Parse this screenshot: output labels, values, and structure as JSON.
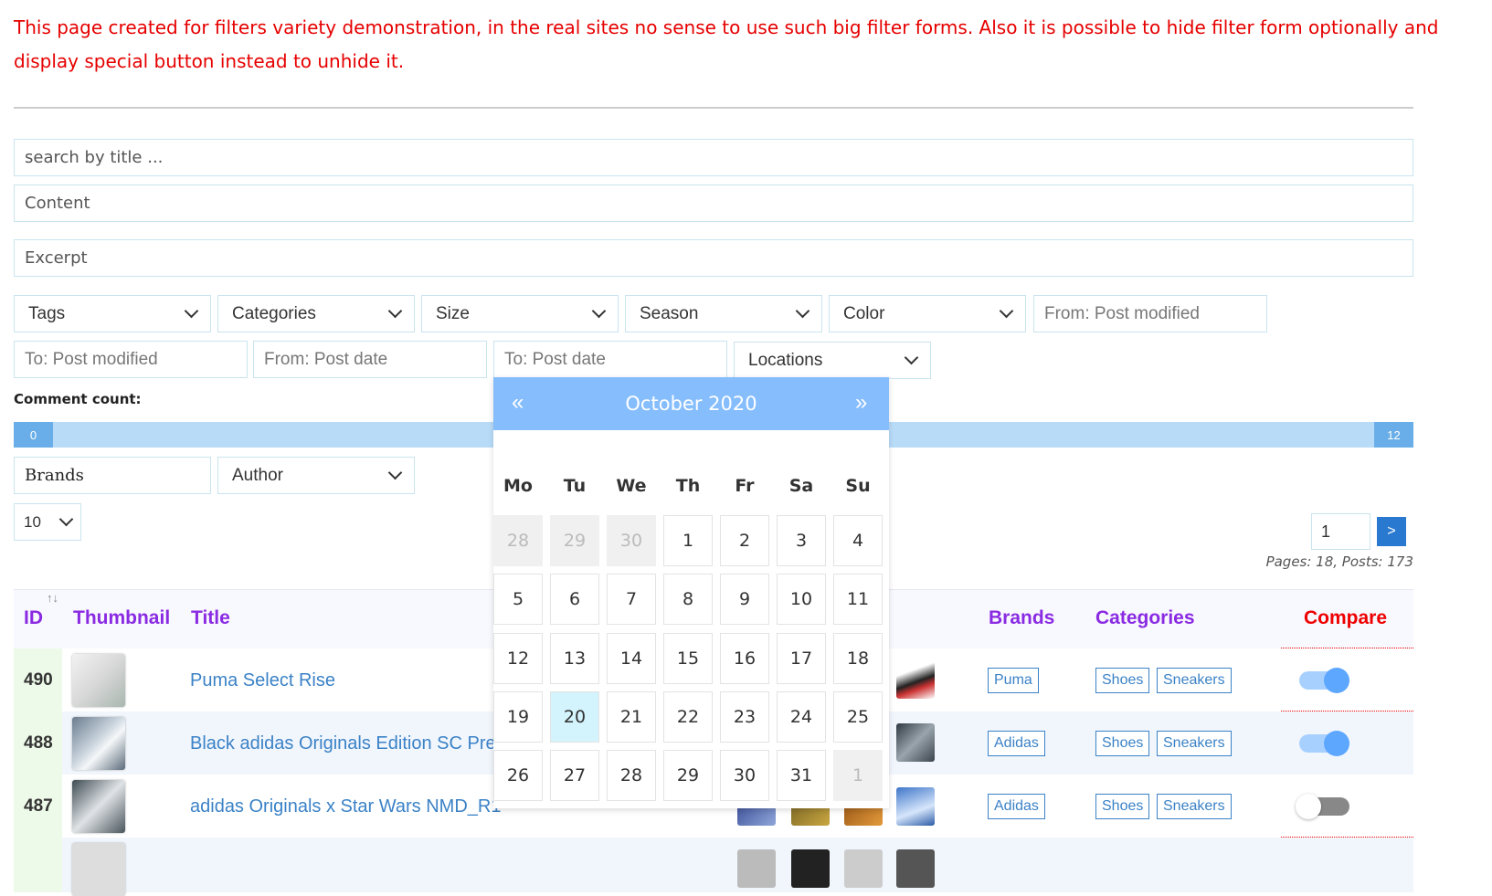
{
  "notice": "This page created for filters variety demonstration, in the real sites no sense to use such big filter forms. Also it is possible to hide filter form optionally and display special button instead to unhide it.",
  "filters": {
    "search_placeholder": "search by title ...",
    "content_placeholder": "Content",
    "excerpt_placeholder": "Excerpt",
    "tags": "Tags",
    "categories": "Categories",
    "size": "Size",
    "season": "Season",
    "color": "Color",
    "from_post_modified": "From: Post modified",
    "to_post_modified": "To: Post modified",
    "from_post_date": "From: Post date",
    "to_post_date": "To: Post date",
    "locations": "Locations",
    "comment_count_label": "Comment count:",
    "slider_min": "0",
    "slider_max": "12",
    "brands": "Brands",
    "author": "Author",
    "per_page": "10"
  },
  "pager": {
    "page": "1",
    "next": ">",
    "info": "Pages: 18, Posts: 173"
  },
  "table": {
    "headers": {
      "id": "ID",
      "sort_icon": "↑↓",
      "thumbnail": "Thumbnail",
      "title": "Title",
      "brands": "Brands",
      "categories": "Categories",
      "compare": "Compare"
    },
    "rows": [
      {
        "id": "490",
        "title": "Puma Select Rise",
        "brand": "Puma",
        "cat1": "Shoes",
        "cat2": "Sneakers",
        "compare": true
      },
      {
        "id": "488",
        "title": "Black adidas Originals Edition SC Prem",
        "brand": "Adidas",
        "cat1": "Shoes",
        "cat2": "Sneakers",
        "compare": true
      },
      {
        "id": "487",
        "title": "adidas Originals x Star Wars NMD_R1",
        "brand": "Adidas",
        "cat1": "Shoes",
        "cat2": "Sneakers",
        "compare": false
      }
    ]
  },
  "datepicker": {
    "title": "October 2020",
    "prev": "«",
    "next": "»",
    "dow": [
      "Mo",
      "Tu",
      "We",
      "Th",
      "Fr",
      "Sa",
      "Su"
    ],
    "weeks": [
      [
        "28",
        "29",
        "30",
        "1",
        "2",
        "3",
        "4"
      ],
      [
        "5",
        "6",
        "7",
        "8",
        "9",
        "10",
        "11"
      ],
      [
        "12",
        "13",
        "14",
        "15",
        "16",
        "17",
        "18"
      ],
      [
        "19",
        "20",
        "21",
        "22",
        "23",
        "24",
        "25"
      ],
      [
        "26",
        "27",
        "28",
        "29",
        "30",
        "31",
        "1"
      ]
    ],
    "today": "20"
  },
  "colors": {
    "accent": "#8a2be2",
    "link": "#3b82c6",
    "notice": "#e60000",
    "toggle_on": "#5da7ff"
  }
}
